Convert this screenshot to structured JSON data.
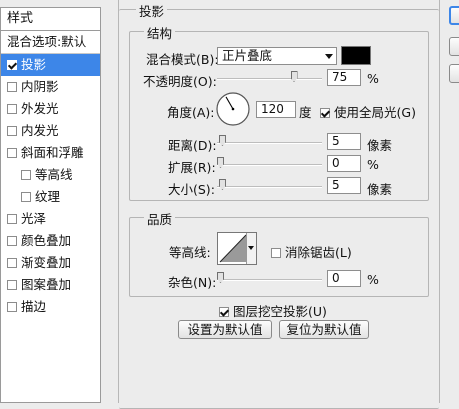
{
  "style_list": {
    "header": "样式",
    "blend_options": "混合选项:默认",
    "items": [
      {
        "label": "投影",
        "checked": true,
        "selected": true,
        "sub": false
      },
      {
        "label": "内阴影",
        "checked": false,
        "selected": false,
        "sub": false
      },
      {
        "label": "外发光",
        "checked": false,
        "selected": false,
        "sub": false
      },
      {
        "label": "内发光",
        "checked": false,
        "selected": false,
        "sub": false
      },
      {
        "label": "斜面和浮雕",
        "checked": false,
        "selected": false,
        "sub": false
      },
      {
        "label": "等高线",
        "checked": false,
        "selected": false,
        "sub": true
      },
      {
        "label": "纹理",
        "checked": false,
        "selected": false,
        "sub": true
      },
      {
        "label": "光泽",
        "checked": false,
        "selected": false,
        "sub": false
      },
      {
        "label": "颜色叠加",
        "checked": false,
        "selected": false,
        "sub": false
      },
      {
        "label": "渐变叠加",
        "checked": false,
        "selected": false,
        "sub": false
      },
      {
        "label": "图案叠加",
        "checked": false,
        "selected": false,
        "sub": false
      },
      {
        "label": "描边",
        "checked": false,
        "selected": false,
        "sub": false
      }
    ]
  },
  "panel": {
    "title": "投影",
    "structure": {
      "title": "结构",
      "blend_mode_label": "混合模式(B):",
      "blend_mode_value": "正片叠底",
      "shadow_color": "#000000",
      "opacity_label": "不透明度(O):",
      "opacity_value": "75",
      "opacity_unit": "%",
      "opacity_fraction": 0.75,
      "angle_label": "角度(A):",
      "angle_value": "120",
      "angle_unit": "度",
      "global_light_label": "使用全局光(G)",
      "global_light_checked": true,
      "distance_label": "距离(D):",
      "distance_value": "5",
      "distance_unit": "像素",
      "distance_fraction": 0.02,
      "spread_label": "扩展(R):",
      "spread_value": "0",
      "spread_unit": "%",
      "spread_fraction": 0.0,
      "size_label": "大小(S):",
      "size_value": "5",
      "size_unit": "像素",
      "size_fraction": 0.02
    },
    "quality": {
      "title": "品质",
      "contour_label": "等高线:",
      "antialias_label": "消除锯齿(L)",
      "antialias_checked": false,
      "noise_label": "杂色(N):",
      "noise_value": "0",
      "noise_unit": "%",
      "noise_fraction": 0.0
    },
    "knockout_label": "图层挖空投影(U)",
    "knockout_checked": true,
    "set_default_label": "设置为默认值",
    "reset_default_label": "复位为默认值"
  }
}
